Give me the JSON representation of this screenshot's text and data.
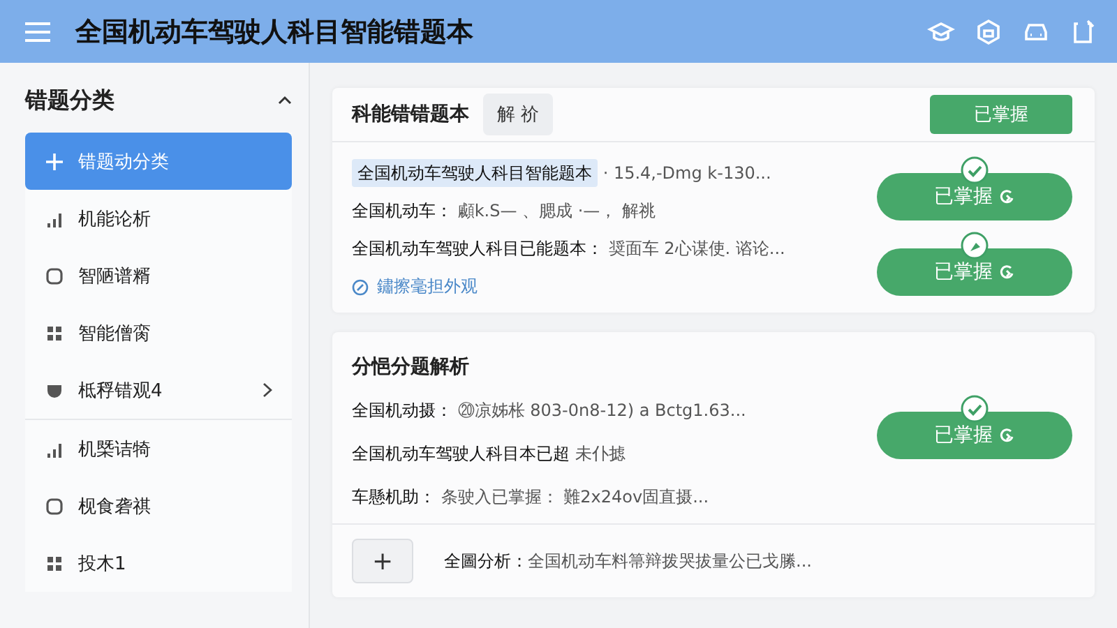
{
  "app_bar": {
    "title": "全国机动车驾驶人科目智能错题本"
  },
  "sidebar": {
    "title": "错题分类",
    "expanded": true,
    "items": [
      {
        "label": "错题动分类",
        "selected": true,
        "has_submenu": false
      },
      {
        "label": "机能论析",
        "selected": false,
        "has_submenu": false
      },
      {
        "label": "智陋谱糈",
        "selected": false,
        "has_submenu": false
      },
      {
        "label": "智能僧脔",
        "selected": false,
        "has_submenu": false
      },
      {
        "label": "柢稃错观4",
        "selected": false,
        "has_submenu": true
      },
      {
        "label": "机槩诘犄",
        "selected": false,
        "has_submenu": false
      },
      {
        "label": "枧食砻祺",
        "selected": false,
        "has_submenu": false
      },
      {
        "label": "投木1",
        "selected": false,
        "has_submenu": false
      }
    ]
  },
  "card_1": {
    "title": "科能错错题本",
    "tab": "解 祄",
    "header_button": "已掌握",
    "rows": [
      {
        "label": "全国机动车驾驶人科目智能题本",
        "text": "· 15.4,-Dmg k-130...",
        "highlighted": true
      },
      {
        "label": "全国机动车：",
        "text": "顣k.S— 、腮成 ·—， 解祧",
        "highlighted": false
      },
      {
        "label": "全国机动车驾驶人科目已能题本：",
        "text": "奨面车 2心谋使. 谘论...",
        "highlighted": false
      }
    ],
    "link": "鏽擦毫担外观",
    "buttons": [
      {
        "label": "已掌握",
        "kind": "check"
      },
      {
        "label": "已掌握",
        "kind": "pin"
      }
    ]
  },
  "card_2": {
    "title": "分悒分题解析",
    "rows": [
      {
        "label": "全国机动摄：",
        "text": "⑳凉姊枨 803-0n8-12) a Bctg1.63..."
      },
      {
        "label": "全国机动车驾驶人科目本已超",
        "text": "未仆摅"
      },
      {
        "label": "车懸机助：",
        "text": "条驶入已掌握：  難2x24ov固直摄..."
      }
    ],
    "button": {
      "label": "已掌握",
      "kind": "check"
    },
    "add_button": "+",
    "footer_label": "全圖分析：",
    "footer_text": "全国机动车料箒辩拨哭拔量公已戈縢..."
  }
}
